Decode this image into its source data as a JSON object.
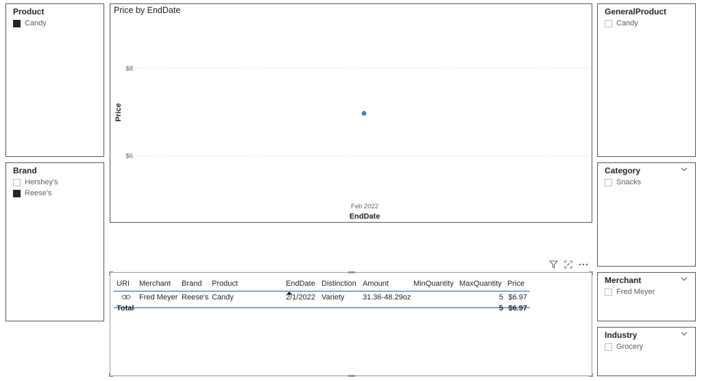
{
  "slicers": {
    "product": {
      "title": "Product",
      "items": [
        {
          "label": "Candy",
          "checked": true
        }
      ]
    },
    "brand": {
      "title": "Brand",
      "items": [
        {
          "label": "Hershey's",
          "checked": false
        },
        {
          "label": "Reese's",
          "checked": true
        }
      ]
    },
    "general_product": {
      "title": "GeneralProduct",
      "items": [
        {
          "label": "Candy",
          "checked": false
        }
      ]
    },
    "category": {
      "title": "Category",
      "items": [
        {
          "label": "Snacks",
          "checked": false
        }
      ]
    },
    "merchant": {
      "title": "Merchant",
      "items": [
        {
          "label": "Fred Meyer",
          "checked": false
        }
      ]
    },
    "industry": {
      "title": "Industry",
      "items": [
        {
          "label": "Grocery",
          "checked": false
        }
      ]
    }
  },
  "chart_data": {
    "type": "scatter",
    "title": "Price by EndDate",
    "xlabel": "EndDate",
    "ylabel": "Price",
    "x_ticks": [
      "Feb 2022"
    ],
    "y_ticks": [
      "$8",
      "$6"
    ],
    "ylim": [
      5.0,
      9.0
    ],
    "grid": true,
    "points": [
      {
        "x": "Feb 2022",
        "y": 6.97
      }
    ],
    "point_color": "#3c7ded"
  },
  "table": {
    "columns": [
      "URI",
      "Merchant",
      "Brand",
      "Product",
      "EndDate",
      "Distinction",
      "Amount",
      "MinQuantity",
      "MaxQuantity",
      "Price"
    ],
    "rows": [
      [
        "",
        "Fred Meyer",
        "Reese's",
        "Candy",
        "2/1/2022",
        "Variety",
        "31.36-48.29oz",
        "",
        "5",
        "$6.97"
      ]
    ],
    "total": {
      "label": "Total",
      "max_quantity": "5",
      "price": "$6.97"
    },
    "sort_column": "EndDate",
    "uri_icon": "link-icon"
  },
  "colors": {
    "accent": "#3c7ded",
    "header_line": "#7aa6e6",
    "border": "#555555"
  }
}
